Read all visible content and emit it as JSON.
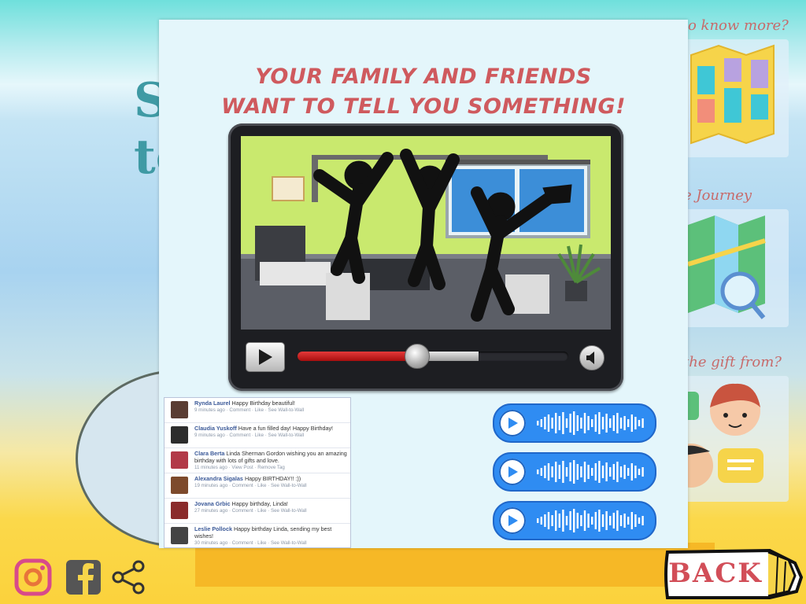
{
  "background": {
    "title_fragment_1": "S",
    "title_fragment_2": "to"
  },
  "right_column": {
    "label_1": "o know more?",
    "label_2": "e Journey",
    "label_3": "the gift from?"
  },
  "modal": {
    "headline_line1": "YOUR FAMILY AND FRIENDS",
    "headline_line2": "WANT TO TELL YOU SOMETHING!"
  },
  "video": {
    "progress": 0.44,
    "buffered": 0.67
  },
  "feed": [
    {
      "name": "Rynda Laurel",
      "message": "Happy Birthday beautiful!",
      "meta": "9 minutes ago · Comment · Like · See Wall-to-Wall"
    },
    {
      "name": "Claudia Yuskoff",
      "message": "Have a fun filled day! Happy Birthday!",
      "meta": "9 minutes ago · Comment · Like · See Wall-to-Wall"
    },
    {
      "name": "Clara Berta",
      "message": "Linda Sherman Gordon wishing you an amazing birthday with lots of gifts and love.",
      "meta": "11 minutes ago · View Post · Remove Tag"
    },
    {
      "name": "Alexandra Sigalas",
      "message": "Happy BIRTHDAY!! :))",
      "meta": "19 minutes ago · Comment · Like · See Wall-to-Wall"
    },
    {
      "name": "Jovana Grbic",
      "message": "Happy birthday, Linda!",
      "meta": "27 minutes ago · Comment · Like · See Wall-to-Wall"
    },
    {
      "name": "Leslie Pollock",
      "message": "Happy birthday Linda, sending my best wishes!",
      "meta": "30 minutes ago · Comment · Like · See Wall-to-Wall"
    }
  ],
  "voice_messages": [
    {
      "icon": "play-icon"
    },
    {
      "icon": "play-icon"
    },
    {
      "icon": "play-icon"
    }
  ],
  "bottom_bar": {
    "instagram_icon": "instagram-icon",
    "facebook_icon": "facebook-icon",
    "share_icon": "share-icon",
    "back_label": "BACK"
  },
  "colors": {
    "headline": "#cf5a5e",
    "voice_bubble": "#2f8cf2",
    "progress_red": "#d32222",
    "back_text": "#d24e58"
  }
}
